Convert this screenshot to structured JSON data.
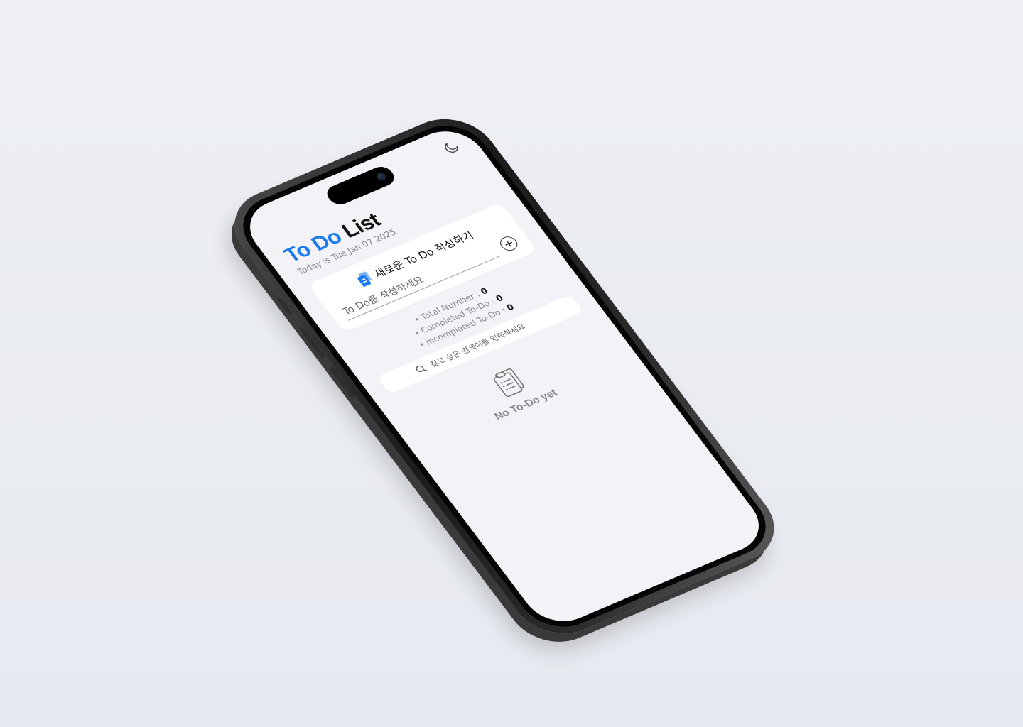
{
  "app": {
    "title_part1": "To Do",
    "title_part2": "List",
    "date_text": "Today is Tue Jan 07 2025"
  },
  "theme": {
    "accent": "#1a7cf0",
    "screen_bg": "#f2f2f7",
    "card_bg": "#ffffff",
    "muted_text": "#8a8a8e"
  },
  "icons": {
    "theme_toggle": "moon-icon",
    "new_todo": "document-icon",
    "add": "plus-circle-icon",
    "search": "search-icon",
    "empty": "clipboard-icon"
  },
  "new_todo": {
    "heading": "새로운 To Do 작성하기",
    "input_value": "",
    "input_placeholder": "To Do를 작성하세요",
    "add_label": "+"
  },
  "stats": [
    {
      "label": "Total Number : ",
      "value": "0"
    },
    {
      "label": "Completed To-Do : ",
      "value": "0"
    },
    {
      "label": "Incompleted To-Do : ",
      "value": "0"
    }
  ],
  "search": {
    "value": "",
    "placeholder": "찾고 싶은 검색어를 입력하세요"
  },
  "empty_state": {
    "text": "No To-Do yet"
  }
}
